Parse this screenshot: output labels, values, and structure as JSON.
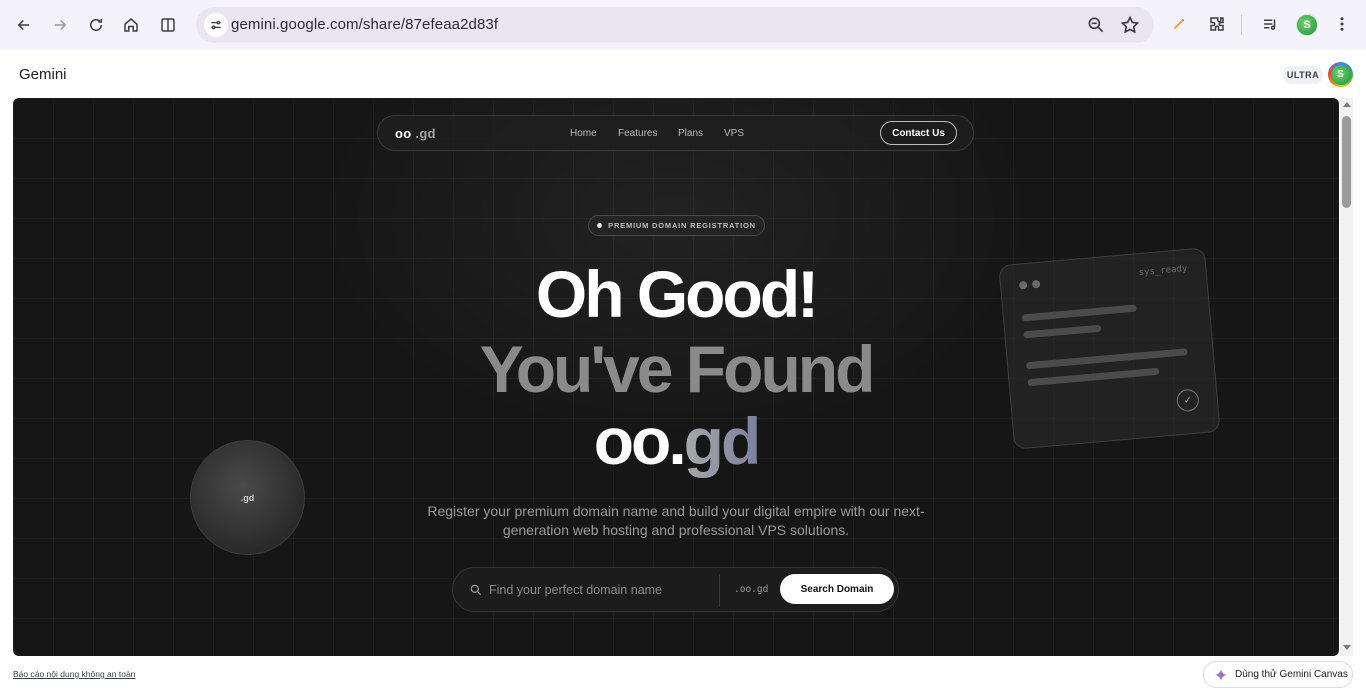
{
  "browser": {
    "url": "gemini.google.com/share/87efeaa2d83f",
    "profile_initial": "S"
  },
  "gemini": {
    "title": "Gemini",
    "plan_badge": "ULTRA",
    "avatar_initial": "S"
  },
  "site": {
    "logo_main": "oo",
    "logo_ext": ".gd",
    "nav_links": [
      "Home",
      "Features",
      "Plans",
      "VPS"
    ],
    "contact_label": "Contact Us",
    "badge": "PREMIUM DOMAIN REGISTRATION",
    "headline_line1": "Oh Good!",
    "headline_line2": "You've Found",
    "headline_line3_main": "oo.",
    "headline_line3_ext": "gd",
    "subtext": "Register your premium domain name and build your digital empire with our next-generation web hosting and professional VPS solutions.",
    "search_placeholder": "Find your perfect domain name",
    "search_value": "",
    "tld": ".oo.gd",
    "search_button": "Search Domain",
    "orb_label": ".gd",
    "card_label": "sys_ready"
  },
  "footer": {
    "report_link": "Báo cáo nội dung không an toàn",
    "canvas_button": "Dùng thử Gemini Canvas"
  },
  "colors": {
    "preview_bg": "#161616",
    "accent_white": "#ffffff",
    "headline_gray": "#8a8a8a",
    "browser_bar": "#f4f2fa"
  }
}
